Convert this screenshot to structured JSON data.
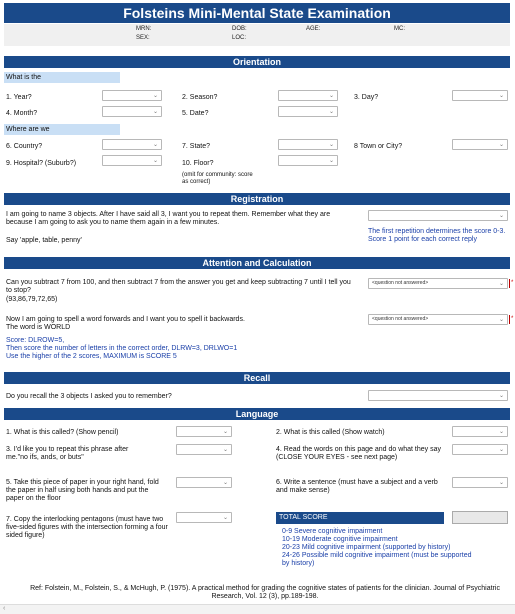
{
  "title": "Folsteins Mini-Mental State Examination",
  "patient": {
    "mrn_label": "MRN:",
    "sex_label": "SEX:",
    "dob_label": "DOB:",
    "loc_label": "LOC:",
    "age_label": "AGE:",
    "mc_label": "MC:"
  },
  "orientation": {
    "header": "Orientation",
    "what_is_the": "What is the",
    "year": "1. Year?",
    "season": "2. Season?",
    "day": "3. Day?",
    "month": "4. Month?",
    "date": "5. Date?",
    "where_are_we": "Where are we",
    "country": "6. Country?",
    "state": "7. State?",
    "town": "8 Town or City?",
    "hospital": "9. Hospital? (Suburb?)",
    "floor": "10. Floor?",
    "floor_note": "(omit for community: score as correct)"
  },
  "registration": {
    "header": "Registration",
    "text": "I am going to name 3 objects. After I have said all 3, I want you to repeat them. Remember what they are because I am going to ask you to name them again in a few minutes.",
    "say": "Say 'apple, table, penny'",
    "note": "The first repetition determines the score 0-3. Score 1 point for each correct reply"
  },
  "attention": {
    "header": "Attention and Calculation",
    "subtract_text": "Can you subtract 7 from 100, and then subtract 7 from the answer you get and keep subtracting 7 until I tell you to stop?",
    "subtract_values": "(93,86,79,72,65)",
    "not_answered_1": "<question not answered>",
    "spell_text": "Now I am going to spell a word forwards and I want you to spell it backwards.",
    "word": "The word is WORLD",
    "not_answered_2": "<question not answered>",
    "score_line1": "Score: DLROW=5,",
    "score_line2": "Then score the number of letters in the correct order, DLRW=3, DRLWO=1",
    "score_line3": "Use the higher of the 2 scores, MAXIMUM is SCORE 5"
  },
  "recall": {
    "header": "Recall",
    "question": "Do you recall the 3 objects I asked you to remember?"
  },
  "language": {
    "header": "Language",
    "q1": "1. What is this called? (Show pencil)",
    "q2": "2. What is this called (Show watch)",
    "q3": "3. I'd like you to repeat this phrase after me.\"no ifs, ands, or buts\"",
    "q4": "4. Read the words on this page and do what they say (CLOSE YOUR EYES - see next page)",
    "q5": "5. Take this piece of paper in your right hand, fold the paper in half using both hands and put the paper on the floor",
    "q6": "6. Write a sentence (must have a subject and a verb and make sense)",
    "q7": "7. Copy the interlocking pentagons (must have two five-sided figures with the intersection forming a four sided figure)",
    "total_label": "TOTAL SCORE",
    "score_key": [
      "0-9 Severe cognitive impairment",
      "10-19 Moderate cognitive impairment",
      "20-23 Mild cognitive impairment (supported by history)",
      "24-26 Possible mild cognitive impairment (must be supported by history)"
    ]
  },
  "reference": "Ref: Folstein, M., Folstein, S., & McHugh, P. (1975). A practical method for grading the cognitive states of patients for the clinician. Journal of Psychiatric Research, Vol. 12 (3), pp.189-198.",
  "colors": {
    "header_bg": "#1a4a8a",
    "light_blue": "#c9dff5",
    "note_blue": "#1a3fa8"
  }
}
